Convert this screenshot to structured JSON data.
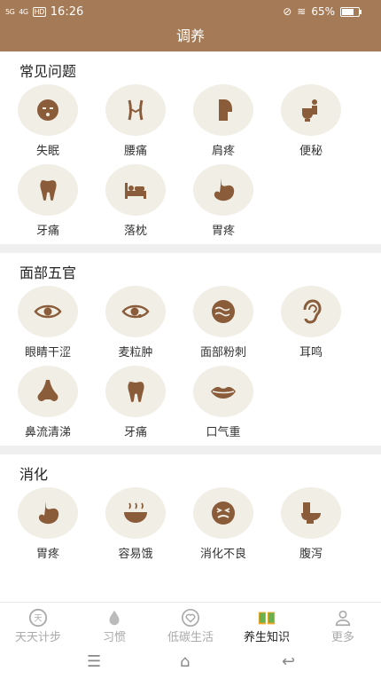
{
  "status": {
    "signal": "5G",
    "signal2": "4G",
    "hd": "HD",
    "time": "16:26",
    "battery": "65%"
  },
  "title": "调养",
  "sections": [
    {
      "title": "常见问题",
      "items": [
        "失眠",
        "腰痛",
        "肩疼",
        "便秘",
        "牙痛",
        "落枕",
        "胃疼"
      ]
    },
    {
      "title": "面部五官",
      "items": [
        "眼睛干涩",
        "麦粒肿",
        "面部粉刺",
        "耳鸣",
        "鼻流清涕",
        "牙痛",
        "口气重"
      ]
    },
    {
      "title": "消化",
      "items": [
        "胃疼",
        "容易饿",
        "消化不良",
        "腹泻"
      ]
    }
  ],
  "tabs": [
    "天天计步",
    "习惯",
    "低碳生活",
    "养生知识",
    "更多"
  ],
  "active_tab": "养生知识",
  "colors": {
    "header": "#a57a57",
    "icon_bg": "#f0eee5",
    "icon": "#8a5c3a"
  }
}
